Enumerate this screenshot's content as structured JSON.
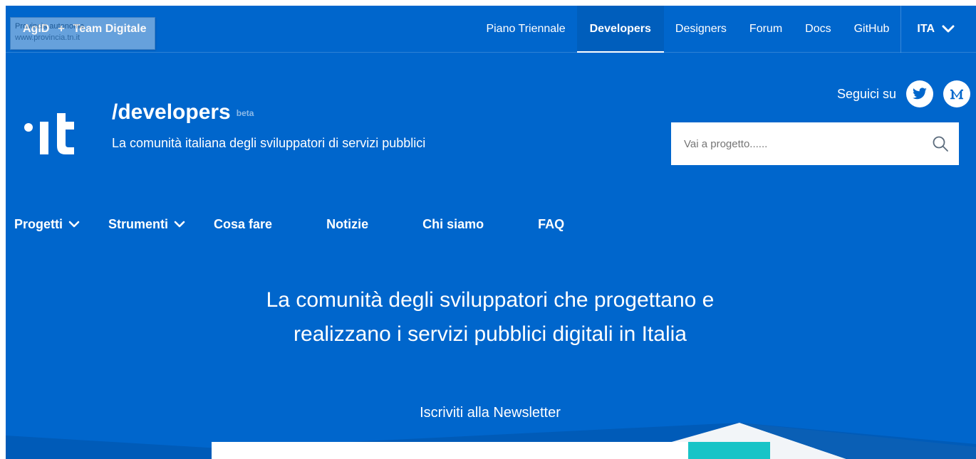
{
  "brand": {
    "agid": "AgID",
    "plus": "+",
    "team": "Team Digitale"
  },
  "tooltip": {
    "line1": "Provincia autonoma",
    "line2": "www.provincia.tn.it"
  },
  "topnav": {
    "items": [
      "Piano Triennale",
      "Developers",
      "Designers",
      "Forum",
      "Docs",
      "GitHub"
    ],
    "active": "Developers",
    "lang": "ITA"
  },
  "header": {
    "title": "/developers",
    "badge": "beta",
    "subtitle": "La comunità italiana degli sviluppatori di servizi pubblici",
    "follow_label": "Seguici su",
    "social": [
      "twitter-icon",
      "medium-icon"
    ]
  },
  "search": {
    "placeholder": "Vai a progetto......"
  },
  "mainnav": {
    "items": [
      {
        "label": "Progetti",
        "has_dropdown": true
      },
      {
        "label": "Strumenti",
        "has_dropdown": true
      },
      {
        "label": "Cosa fare",
        "has_dropdown": false
      },
      {
        "label": "Notizie",
        "has_dropdown": false
      },
      {
        "label": "Chi siamo",
        "has_dropdown": false
      },
      {
        "label": "FAQ",
        "has_dropdown": false
      }
    ]
  },
  "hero": {
    "line1": "La comunità degli sviluppatori che progettano e",
    "line2": "realizzano i servizi pubblici digitali in Italia"
  },
  "newsletter": {
    "label": "Iscriviti alla Newsletter"
  },
  "colors": {
    "primary": "#0066CC",
    "accent": "#18C4C7",
    "text": "#FFFFFF"
  }
}
